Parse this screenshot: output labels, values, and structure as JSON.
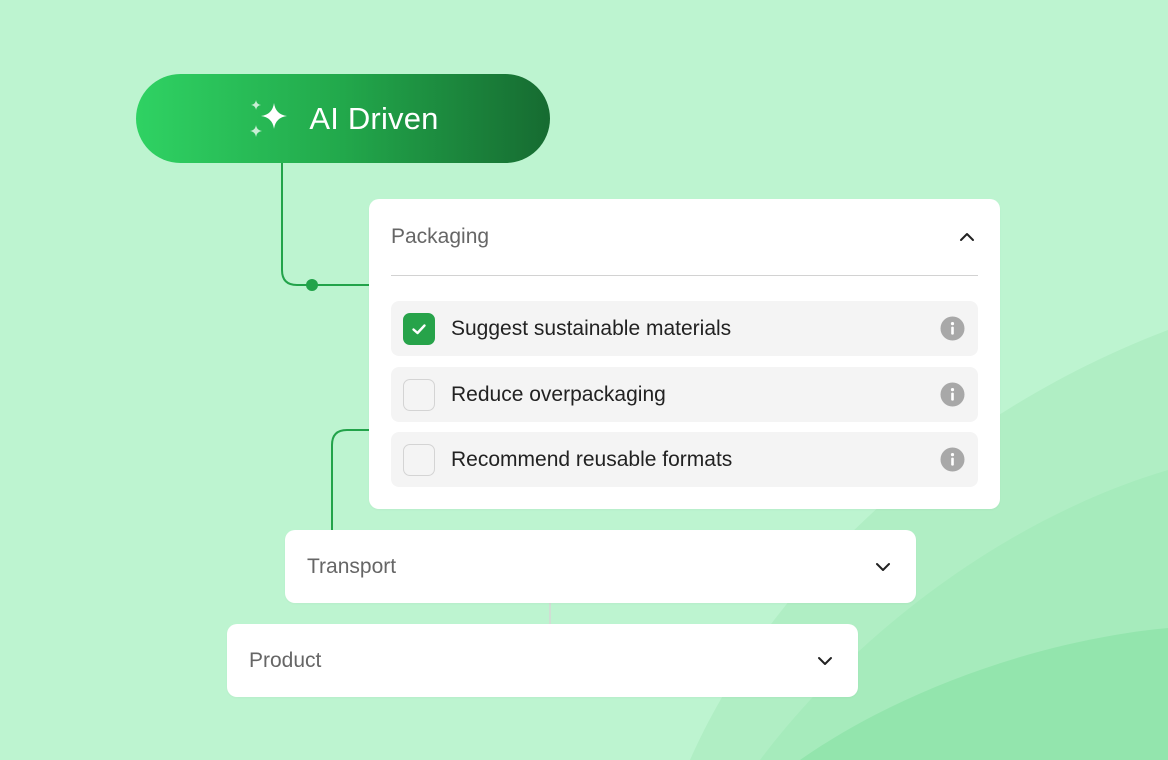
{
  "pill": {
    "title": "AI Driven",
    "icon": "sparkle-icon"
  },
  "sections": {
    "packaging": {
      "title": "Packaging",
      "state": "expanded",
      "options": [
        {
          "label": "Suggest sustainable materials",
          "checked": true
        },
        {
          "label": "Reduce overpackaging",
          "checked": false
        },
        {
          "label": "Recommend reusable formats",
          "checked": false
        }
      ]
    },
    "transport": {
      "title": "Transport",
      "state": "collapsed"
    },
    "product": {
      "title": "Product",
      "state": "collapsed"
    }
  },
  "colors": {
    "background": "#bdf4d0",
    "accent": "#27a34a",
    "connector": "#22a34a",
    "pill_start": "#2fd263",
    "pill_end": "#166b31"
  }
}
